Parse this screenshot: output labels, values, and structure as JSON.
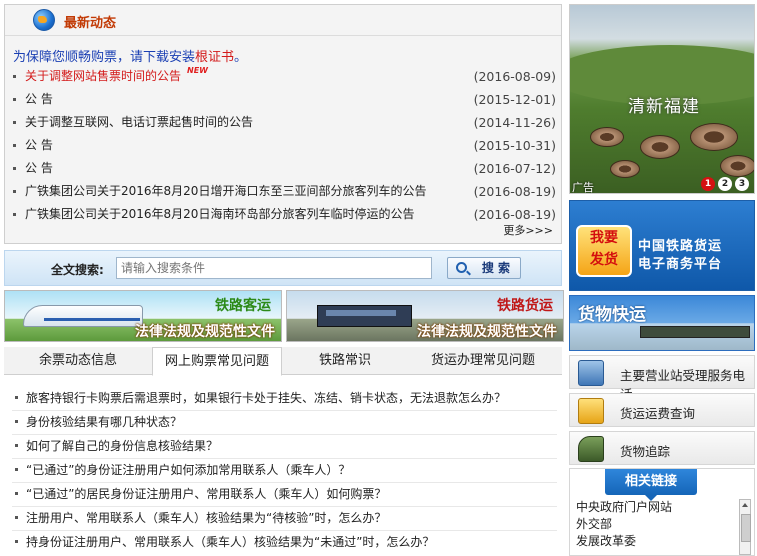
{
  "news": {
    "title": "最新动态",
    "notice_prefix": "为保障您顺畅购票，请下载安装",
    "notice_link": "根证书",
    "notice_suffix": "。",
    "new_tag": "NEW",
    "items": [
      {
        "text": "关于调整网站售票时间的公告",
        "date": "(2016-08-09)",
        "is_new": true
      },
      {
        "text": "公  告",
        "date": "(2015-12-01)"
      },
      {
        "text": "关于调整互联网、电话订票起售时间的公告",
        "date": "(2014-11-26)"
      },
      {
        "text": "公  告",
        "date": "(2015-10-31)"
      },
      {
        "text": "公  告",
        "date": "(2016-07-12)"
      },
      {
        "text": "广铁集团公司关于2016年8月20日增开海口东至三亚间部分旅客列车的公告",
        "date": "(2016-08-19)"
      },
      {
        "text": "广铁集团公司关于2016年8月20日海南环岛部分旅客列车临时停运的公告",
        "date": "(2016-08-19)"
      }
    ],
    "more": "更多>>>"
  },
  "search": {
    "label": "全文搜索:",
    "placeholder": "请输入搜索条件",
    "button": "搜 索"
  },
  "banners": {
    "passenger": {
      "title": "铁路客运",
      "subtitle": "法律法规及规范性文件"
    },
    "freight": {
      "title": "铁路货运",
      "subtitle": "法律法规及规范性文件"
    }
  },
  "tabs": [
    "余票动态信息",
    "网上购票常见问题",
    "铁路常识",
    "货运办理常见问题"
  ],
  "active_tab": 1,
  "faq": [
    "旅客持银行卡购票后需退票时，如果银行卡处于挂失、冻结、销卡状态，无法退款怎么办？",
    "身份核验结果有哪几种状态？",
    "如何了解自己的身份信息核验结果？",
    "“已通过”的身份证注册用户如何添加常用联系人（乘车人）？",
    "“已通过”的居民身份证注册用户、常用联系人（乘车人）如何购票？",
    "注册用户、常用联系人（乘车人）核验结果为“待核验”时，怎么办？",
    "持身份证注册用户、常用联系人（乘车人）核验结果为“未通过”时，怎么办？"
  ],
  "promo": {
    "caption": "清新福建",
    "ad_label": "广告",
    "dots": [
      "1",
      "2",
      "3"
    ]
  },
  "freight_platform": {
    "sign_top": "我要",
    "sign_bottom": "发货",
    "line1": "中国铁路货运",
    "line2": "电子商务平台"
  },
  "fast_freight": {
    "title": "货物快运"
  },
  "services": [
    {
      "label": "主要营业站受理服务电话",
      "icon": "phone-icon"
    },
    {
      "label": "货运运费查询",
      "icon": "calculator-icon"
    },
    {
      "label": "货物追踪",
      "icon": "locomotive-icon"
    }
  ],
  "links": {
    "title": "相关链接",
    "items": [
      "中央政府门户网站",
      "外交部",
      "发展改革委"
    ]
  }
}
